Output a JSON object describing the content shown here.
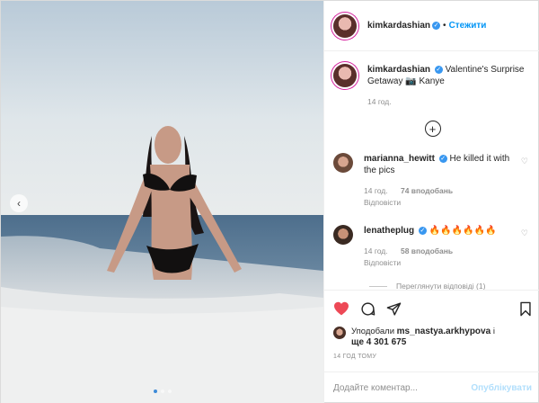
{
  "post": {
    "author": "kimkardashian",
    "follow_label": "Стежити",
    "separator": "•",
    "verified_icon": "✓"
  },
  "caption": {
    "author": "kimkardashian",
    "text": "Valentine's Surprise Getaway 📷 Kanye",
    "time": "14 год."
  },
  "load_more_icon": "+",
  "comments": [
    {
      "author": "marianna_hewitt",
      "verified": true,
      "text": "He killed it with the pics",
      "time": "14 год.",
      "likes": "74 вподобань",
      "reply": "Відповісти"
    },
    {
      "author": "lenatheplug",
      "verified": true,
      "text": "🔥🔥🔥🔥🔥🔥",
      "time": "14 год.",
      "likes": "58 вподобань",
      "reply": "Відповісти",
      "view_replies": "Переглянути відповіді (1)"
    }
  ],
  "footer": {
    "likes_prefix": "Уподобали",
    "liker": "ms_nastya.arkhypova",
    "likes_suffix": "і",
    "likes_more": "ще 4 301 675",
    "timestamp": "14 год тому",
    "comment_placeholder": "Додайте коментар...",
    "publish_label": "Опублікувати"
  },
  "carousel": {
    "current": 1,
    "total": 3
  },
  "colors": {
    "accent": "#0095f6",
    "heart": "#ed4956",
    "verified": "#3897f0"
  }
}
